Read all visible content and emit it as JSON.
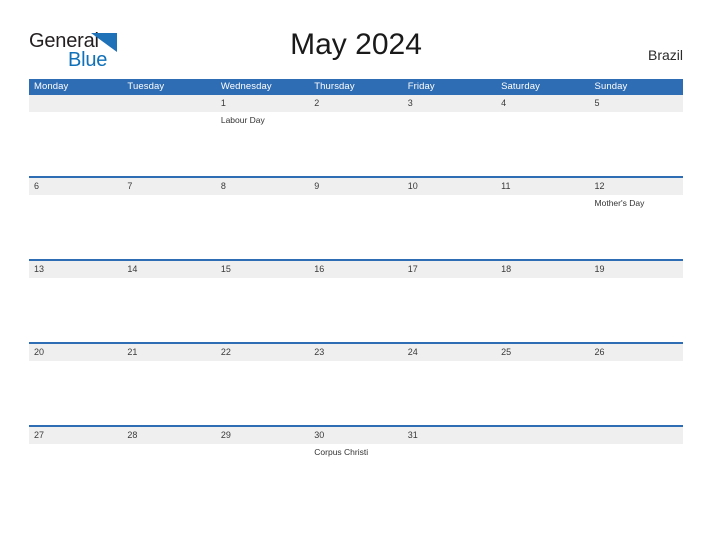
{
  "brand": {
    "name_part1": "General",
    "name_part2": "Blue",
    "triangle_icon": "blue-triangle-icon",
    "dark_color": "#231f20",
    "blue_color": "#1070b8"
  },
  "header": {
    "title": "May 2024",
    "country": "Brazil"
  },
  "theme": {
    "header_blue": "#2e6db4",
    "day_band_gray": "#efefef",
    "separator_blue": "#2e6db4",
    "text_dark": "#1a1a1a"
  },
  "calendar": {
    "weekdays": [
      "Monday",
      "Tuesday",
      "Wednesday",
      "Thursday",
      "Friday",
      "Saturday",
      "Sunday"
    ],
    "weeks": [
      {
        "days": [
          {
            "date": "",
            "event": ""
          },
          {
            "date": "",
            "event": ""
          },
          {
            "date": "1",
            "event": "Labour Day"
          },
          {
            "date": "2",
            "event": ""
          },
          {
            "date": "3",
            "event": ""
          },
          {
            "date": "4",
            "event": ""
          },
          {
            "date": "5",
            "event": ""
          }
        ]
      },
      {
        "days": [
          {
            "date": "6",
            "event": ""
          },
          {
            "date": "7",
            "event": ""
          },
          {
            "date": "8",
            "event": ""
          },
          {
            "date": "9",
            "event": ""
          },
          {
            "date": "10",
            "event": ""
          },
          {
            "date": "11",
            "event": ""
          },
          {
            "date": "12",
            "event": "Mother's Day"
          }
        ]
      },
      {
        "days": [
          {
            "date": "13",
            "event": ""
          },
          {
            "date": "14",
            "event": ""
          },
          {
            "date": "15",
            "event": ""
          },
          {
            "date": "16",
            "event": ""
          },
          {
            "date": "17",
            "event": ""
          },
          {
            "date": "18",
            "event": ""
          },
          {
            "date": "19",
            "event": ""
          }
        ]
      },
      {
        "days": [
          {
            "date": "20",
            "event": ""
          },
          {
            "date": "21",
            "event": ""
          },
          {
            "date": "22",
            "event": ""
          },
          {
            "date": "23",
            "event": ""
          },
          {
            "date": "24",
            "event": ""
          },
          {
            "date": "25",
            "event": ""
          },
          {
            "date": "26",
            "event": ""
          }
        ]
      },
      {
        "days": [
          {
            "date": "27",
            "event": ""
          },
          {
            "date": "28",
            "event": ""
          },
          {
            "date": "29",
            "event": ""
          },
          {
            "date": "30",
            "event": "Corpus Christi"
          },
          {
            "date": "31",
            "event": ""
          },
          {
            "date": "",
            "event": ""
          },
          {
            "date": "",
            "event": ""
          }
        ]
      }
    ]
  }
}
